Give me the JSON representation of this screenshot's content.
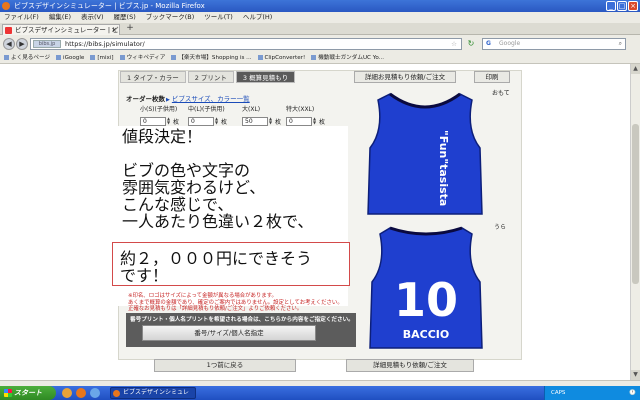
{
  "browser": {
    "title": "ビブスデザインシミュレーター | ビブス.jp - Mozilla Firefox",
    "menu": [
      "ファイル(F)",
      "編集(E)",
      "表示(V)",
      "履歴(S)",
      "ブックマーク(B)",
      "ツール(T)",
      "ヘルプ(H)"
    ],
    "tab_title": "ビブスデザインシミュレーター | ビブス.jp",
    "new_tab": "+",
    "url": "https://bibs.jp/simulator/",
    "site_badge": "bibs.jp",
    "search_placeholder": "Google",
    "bookmarks": [
      "よく見るページ",
      "iGoogle",
      "[mixi]",
      "ウィキペディア",
      "【楽天市場】Shopping is ...",
      "ClipConverter!",
      "機動戦士ガンダムUC Yo..."
    ]
  },
  "page": {
    "steps": [
      "1  タイプ・カラー",
      "2  プリント",
      "3  概算見積もり"
    ],
    "estimate_button": "詳細お見積もり依頼/ご注文",
    "print_button": "印刷",
    "order_label": "オーダー枚数",
    "size_link": "ビブスサイズ、カラー一覧",
    "sizes": [
      {
        "label": "小(S)(子供用)",
        "value": "0",
        "unit": "枚"
      },
      {
        "label": "中(L)(子供用)",
        "value": "0",
        "unit": "枚"
      },
      {
        "label": "大(XL)",
        "value": "50",
        "unit": "枚"
      },
      {
        "label": "特大(XXL)",
        "value": "0",
        "unit": "枚"
      }
    ],
    "overlay_text": "値段決定！\n\nビブの色や文字の\n雰囲気変わるけど、\nこんな感じで、\n一人あたり色違い２枚で、",
    "note_text": "約２，０００円にできそう\nです！",
    "warning_lines": [
      "※印名、ロゴはサイズによって金額が異なる場合があります。",
      "あくまで概算の金額であり、確定のご案内ではありません。設定としてお考えください。",
      "正確なお見積もりは「詳細見積もり依頼/ご注文」よりご依頼ください。"
    ],
    "name_panel_title": "番号プリント・個人名プリントを希望される場合は、こちらから内容をご指定ください。",
    "name_button": "番号/サイズ/個人名指定",
    "label_front": "おもて",
    "label_back": "うら",
    "bib_front_text": "\"Fun\"tasista",
    "bib_back_number": "10",
    "bib_back_name": "BACCIO",
    "bib_color": "#1f3fcf",
    "back_button": "1つ前に戻る",
    "next_button": "詳細見積もり依頼/ご注文"
  },
  "taskbar": {
    "start": "スタート",
    "task": "ビブスデザインシミュレー...",
    "tray": "CAPS"
  }
}
